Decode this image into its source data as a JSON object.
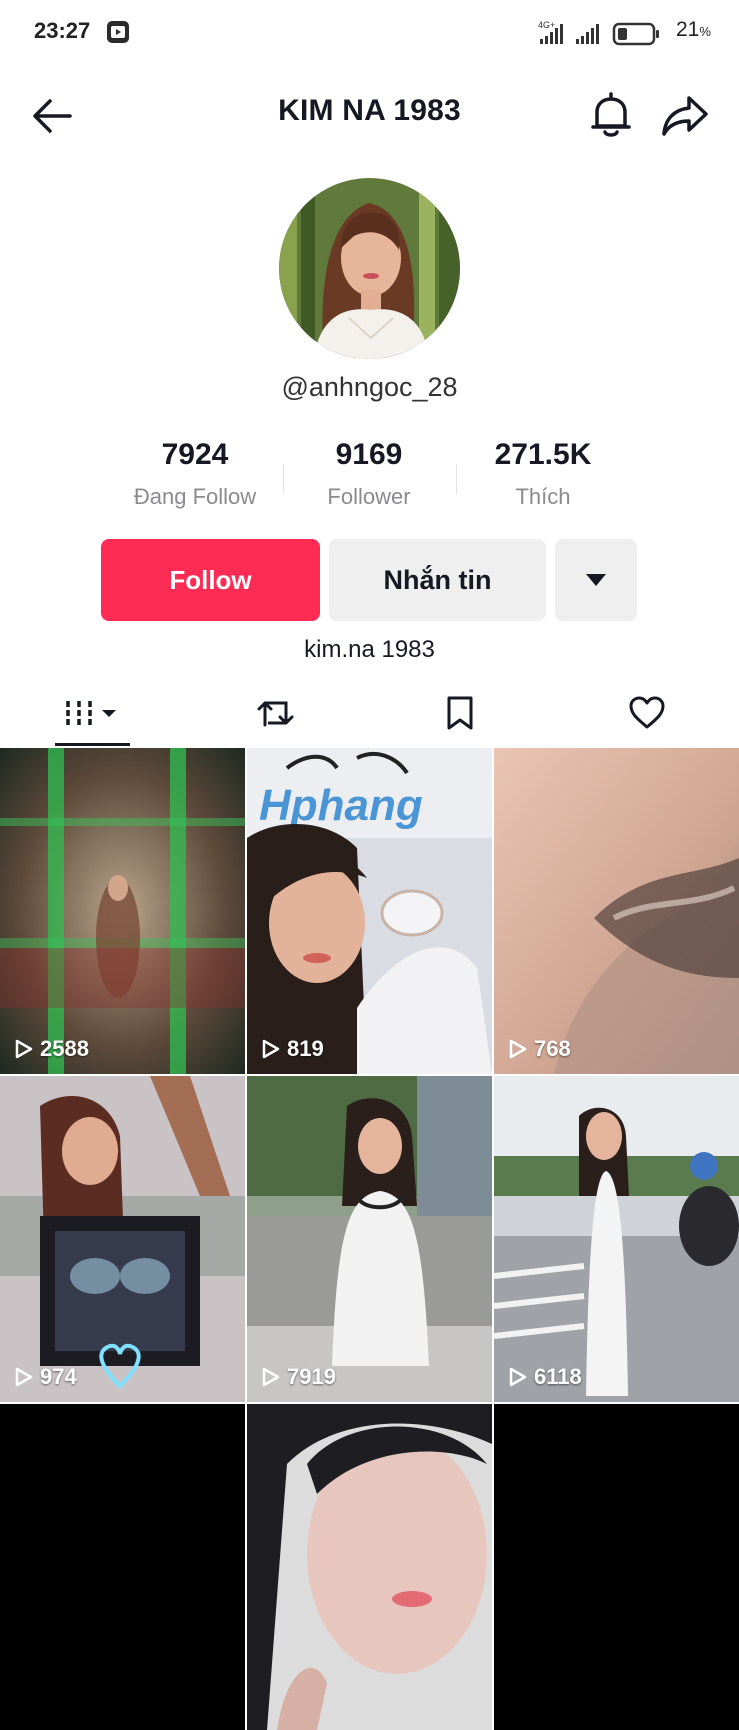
{
  "status_bar": {
    "time": "23:27",
    "network": "4G+",
    "battery": "21",
    "battery_unit": "%"
  },
  "header": {
    "title": "KIM NA 1983"
  },
  "profile": {
    "username": "@anhngoc_28",
    "stats": [
      {
        "value": "7924",
        "label": "Đang Follow"
      },
      {
        "value": "9169",
        "label": "Follower"
      },
      {
        "value": "271.5K",
        "label": "Thích"
      }
    ],
    "bio": "kim.na 1983"
  },
  "actions": {
    "follow_label": "Follow",
    "message_label": "Nhắn tin"
  },
  "tabs": [
    "videos-icon",
    "repost-icon",
    "bookmark-icon",
    "heart-icon"
  ],
  "videos": [
    {
      "views": "2588"
    },
    {
      "views": "819"
    },
    {
      "views": "768"
    },
    {
      "views": "974"
    },
    {
      "views": "7919"
    },
    {
      "views": "6118"
    },
    {
      "views": ""
    },
    {
      "views": ""
    },
    {
      "views": ""
    }
  ],
  "colors": {
    "accent": "#fe2c55",
    "secondary_button": "#efeff0",
    "muted_text": "#8a8b91"
  }
}
